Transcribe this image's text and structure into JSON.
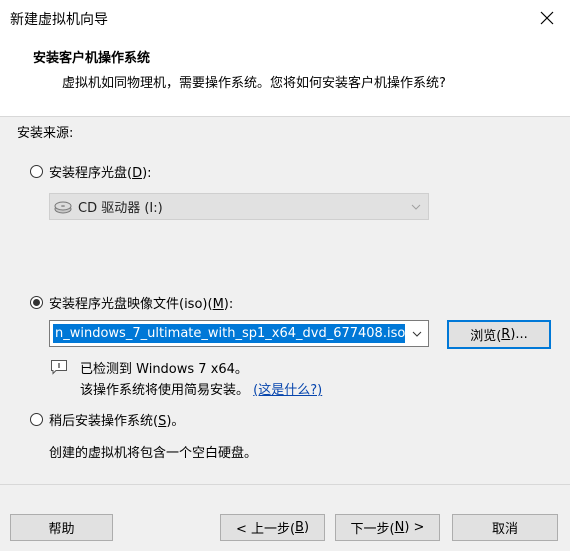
{
  "window": {
    "title": "新建虚拟机向导"
  },
  "header": {
    "title": "安装客户机操作系统",
    "subtitle": "虚拟机如同物理机，需要操作系统。您将如何安装客户机操作系统?"
  },
  "install_source": {
    "label": "安装来源:",
    "options": [
      {
        "label_pre": "安装程序光盘(",
        "mnemonic": "D",
        "label_post": "):",
        "selected": false
      },
      {
        "label_pre": "安装程序光盘映像文件(iso)(",
        "mnemonic": "M",
        "label_post": "):",
        "selected": true
      },
      {
        "label_pre": "稍后安装操作系统(",
        "mnemonic": "S",
        "label_post": ")。",
        "selected": false
      }
    ],
    "cd_drive": {
      "value": "CD 驱动器 (I:)"
    },
    "iso_path": {
      "value": "n_windows_7_ultimate_with_sp1_x64_dvd_677408.iso"
    },
    "browse_button": {
      "label_pre": "浏览(",
      "mnemonic": "R",
      "label_post": ")..."
    },
    "detect": {
      "line1": "已检测到 Windows 7 x64。",
      "line2": "该操作系统将使用简易安装。",
      "link": "(这是什么?)"
    },
    "later_desc": "创建的虚拟机将包含一个空白硬盘。"
  },
  "footer": {
    "help": "帮助",
    "back": {
      "label_pre": "< 上一步(",
      "mnemonic": "B",
      "label_post": ")"
    },
    "next": {
      "label_pre": "下一步(",
      "mnemonic": "N",
      "label_post": ") >"
    },
    "cancel": "取消"
  },
  "colors": {
    "selection": "#0078d7",
    "focus_border": "#0078d7",
    "link": "#0645ad"
  },
  "icons": {
    "close": "close-icon",
    "cd": "cd-drive-icon",
    "info": "info-icon",
    "dropdown": "chevron-down-icon"
  }
}
